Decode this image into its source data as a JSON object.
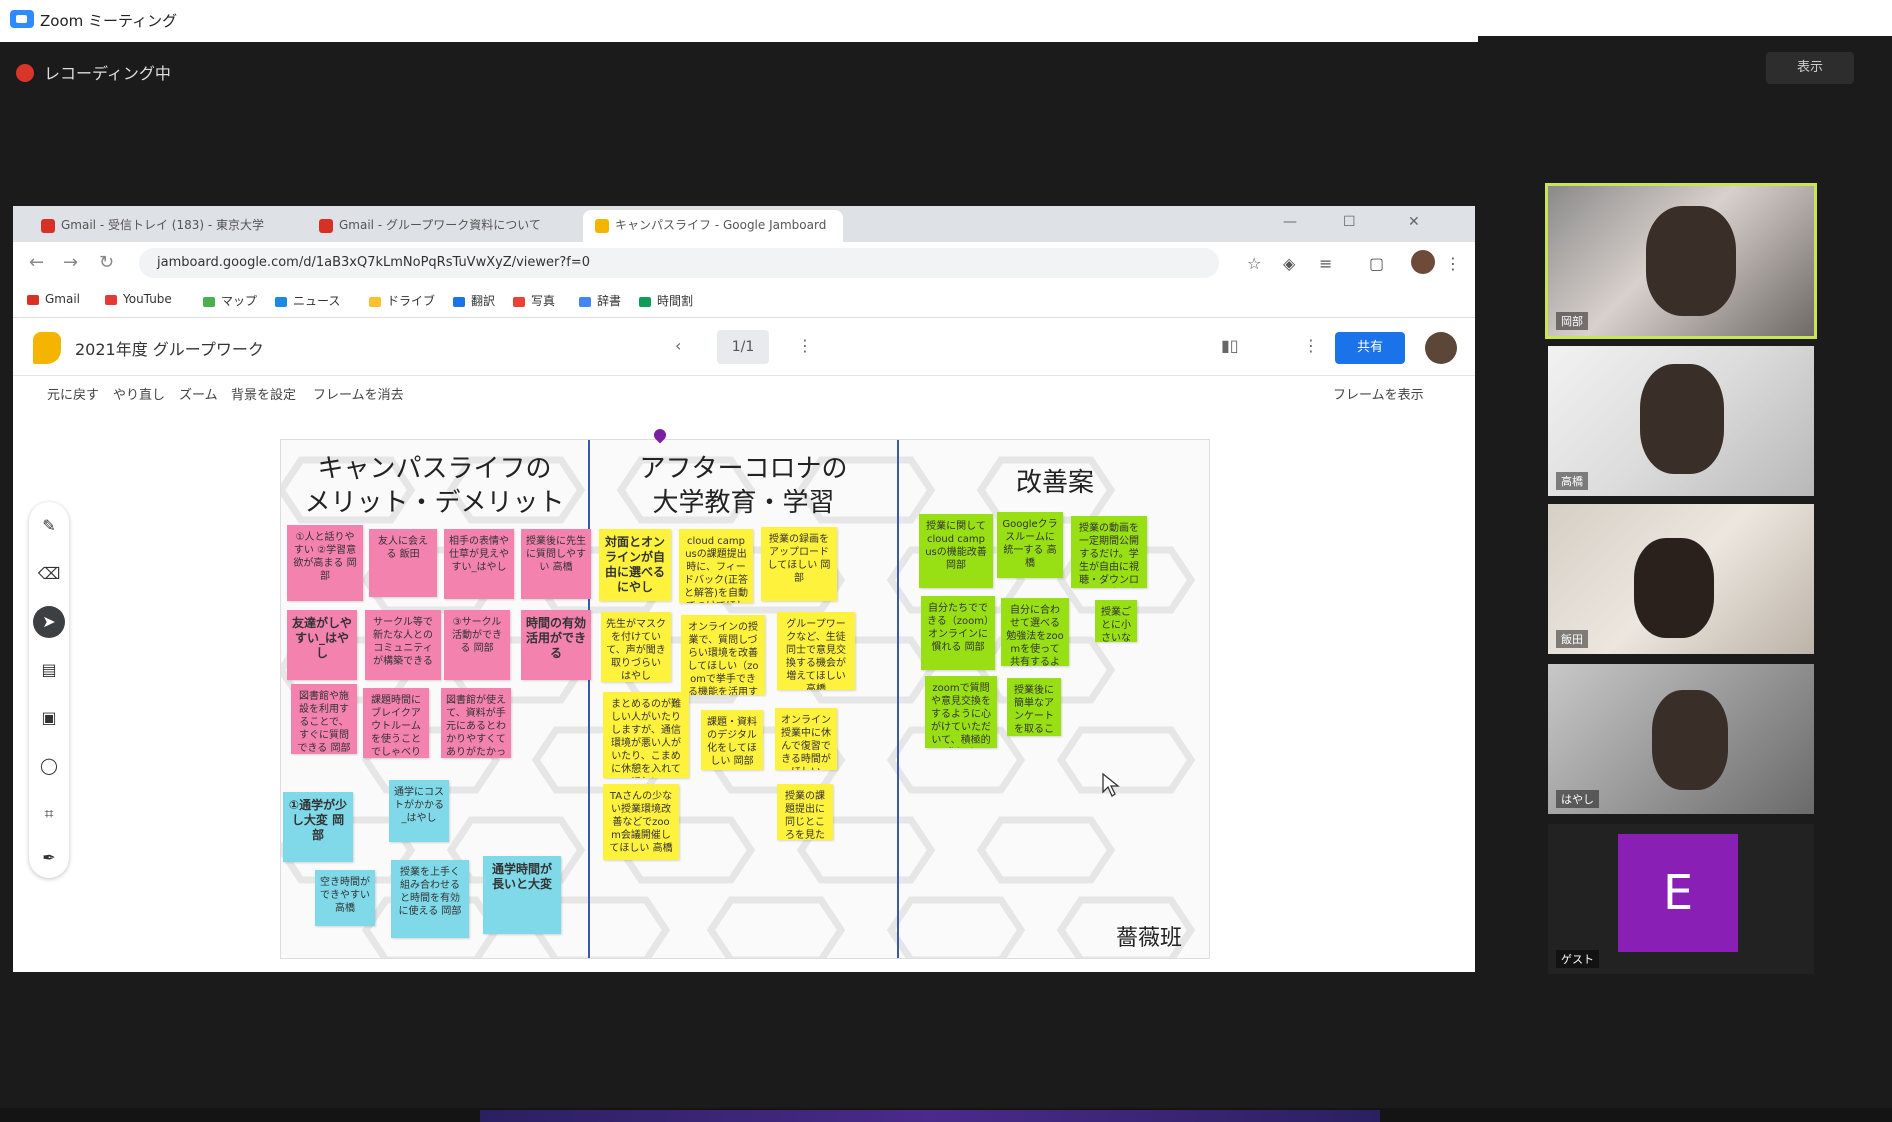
{
  "app": {
    "title": "Zoom ミーティング"
  },
  "meeting": {
    "title": "レコーディング中",
    "view_label": "表示"
  },
  "browser": {
    "tabs": [
      {
        "label": "Gmail - 受信トレイ (183) - 東京大学",
        "color": "#d93025"
      },
      {
        "label": "Gmail - グループワーク資料について",
        "color": "#d93025"
      },
      {
        "label": "キャンパスライフ - Google Jamboard",
        "color": "#f4b400"
      }
    ],
    "url": "jamboard.google.com/d/1aB3xQ7kLmNoPqRsTuVwXyZ/viewer?f=0",
    "bookmarks": [
      {
        "label": "Gmail",
        "color": "#d93025"
      },
      {
        "label": "YouTube",
        "color": "#e53935"
      },
      {
        "label": "マップ",
        "color": "#4caf50"
      },
      {
        "label": "ニュース",
        "color": "#1e88e5"
      },
      {
        "label": "ドライブ",
        "color": "#fbc02d"
      },
      {
        "label": "翻訳",
        "color": "#1a73e8"
      },
      {
        "label": "写真",
        "color": "#ea4335"
      },
      {
        "label": "辞書",
        "color": "#4285f4"
      },
      {
        "label": "時間割",
        "color": "#0f9d58"
      }
    ]
  },
  "jamboard": {
    "title": "2021年度 グループワーク",
    "frame_label": "1/1",
    "share_label": "共有",
    "toolbar": [
      "元に戻す",
      "やり直し",
      "ズーム",
      "背景を設定",
      "フレームを消去"
    ],
    "toolbar_right": "フレームを表示"
  },
  "board": {
    "columns": [
      {
        "heading_line1": "キャンパスライフの",
        "heading_line2": "メリット・デメリット"
      },
      {
        "heading_line1": "アフターコロナの",
        "heading_line2": "大学教育・学習"
      },
      {
        "heading_line1": "改善案",
        "heading_line2": ""
      }
    ],
    "signature": "薔薇班",
    "notes": {
      "pink": [
        "①人と話りやすい ②学習意欲が高まる 岡部",
        "友人に会える 飯田",
        "相手の表情や仕草が見えやすい_はやし",
        "授業後に先生に質問しやすい 高橋",
        "友達がしやすい_はやし",
        "サークル等で新たな人とのコミュニティが構築できる",
        "③サークル活動ができる 岡部",
        "時間の有効活用ができる",
        "図書館や施設を利用することで、すぐに質問できる 岡部",
        "課題時間にブレイクアウトルームを使うことでしゃべりやすい環境作りをしている",
        "図書館が使えて、資料が手元にあるとわかりやすくてありがたかった"
      ],
      "yellow": [
        "対面とオンラインが自由に選べるにやし",
        "cloud campusの課題提出時に、フィードバック(正答と解答)を自動でつけてほしい 岡部",
        "授業の録画をアップロードしてほしい 岡部",
        "先生がマスクを付けていて、声が聞き取りづらい はやし",
        "オンラインの授業で、質問しづらい環境を改善してほしい（zoomで挙手できる機能を活用するなど）高橋",
        "グループワークなど、生徒同士で意見交換する機会が増えてほしい 高橋",
        "まとめるのが難しい人がいたりしますが、通信環境が悪い人がいたり、こまめに休憩を入れてほしい",
        "課題・資料のデジタル化をしてほしい 岡部",
        "オンライン授業中に休んで復習できる時間がほしい",
        "TAさんの少ない授業環境改善などでzoom会議開催してほしい 高橋",
        "授業の課題提出に同じところを見たり、できるようにしてほしい"
      ],
      "green": [
        "授業に関してcloud campusの機能改善 岡部",
        "Googleクラスルームに統一する 高橋",
        "授業の動画を一定期間公開するだけ。学生が自由に視聴・ダウンロードできるようにしてほしい はやし",
        "自分たちでできる（zoom）オンラインに慣れる 岡部",
        "自分に合わせて選べる勉強法をzoomを使って共有するように 高橋",
        "授業ごとに小さいな課題を出す",
        "zoomで質問や意見交換をするように心がけていただいて、積極的に参加する 岡部",
        "授業後に簡単なアンケートを取ることで、授業の改善につなげる"
      ],
      "cyan": [
        "①通学が少し大変 岡部",
        "通学にコストがかかる_はやし",
        "空き時間ができやすい 高橋",
        "授業を上手く組み合わせると時間を有効に使える 岡部",
        "通学時間が長いと大変"
      ]
    }
  },
  "participants": [
    {
      "name": "岡部",
      "speaking": true
    },
    {
      "name": "高橋",
      "speaking": false
    },
    {
      "name": "飯田",
      "speaking": false
    },
    {
      "name": "はやし",
      "speaking": false
    },
    {
      "name": "ゲスト",
      "initial": "E",
      "speaking": false
    }
  ]
}
